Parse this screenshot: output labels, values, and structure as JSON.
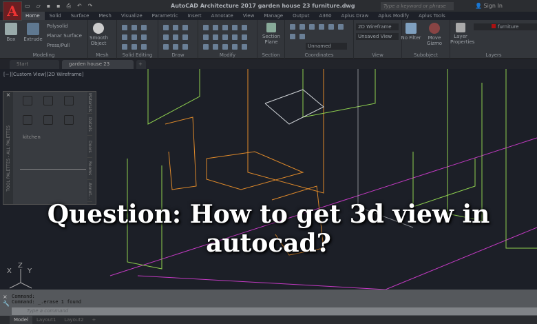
{
  "app": {
    "logo": "A",
    "title": "AutoCAD Architecture 2017   garden house 23 furniture.dwg",
    "search_placeholder": "Type a keyword or phrase",
    "sign_in": "Sign In"
  },
  "ribbon_tabs": [
    "Home",
    "Solid",
    "Surface",
    "Mesh",
    "Visualize",
    "Parametric",
    "Insert",
    "Annotate",
    "View",
    "Manage",
    "Output",
    "A360",
    "Aplus Draw",
    "Aplus Modify",
    "Aplus Tools"
  ],
  "active_tab": "Home",
  "panels": {
    "modeling": "Modeling",
    "mesh": "Mesh",
    "solid_editing": "Solid Editing",
    "draw": "Draw",
    "modify": "Modify",
    "section": "Section",
    "coordinates": "Coordinates",
    "view": "View",
    "subobject": "Subobject",
    "layers": "Layers"
  },
  "buttons": {
    "box": "Box",
    "extrude": "Extrude",
    "polysolid": "Polysolid",
    "planar_surface": "Planar Surface",
    "presspull": "Press/Pull",
    "smooth_object": "Smooth Object",
    "section_plane": "Section Plane",
    "no_filter": "No Filter",
    "move_gizmo": "Move Gizmo",
    "layer_properties": "Layer Properties"
  },
  "dropdowns": {
    "visual_style": "2D Wireframe",
    "named_view": "Unsaved View",
    "ucs": "Unnamed",
    "layer": "furniture"
  },
  "doc_tabs": [
    "Start",
    "garden house 23 furniture*"
  ],
  "viewport": {
    "label": "[−][Custom View][2D Wireframe]",
    "palette_category": "kitchen",
    "palette_title": "TOOL PALETTES - ALL PALETTES",
    "palette_side_tabs": [
      "Materials",
      "Details",
      "Doors",
      "Rooms",
      "Annot..."
    ]
  },
  "headline": "Question: How to get 3d view in autocad?",
  "command": {
    "lines": [
      "Command:",
      "Command:  _.erase 1 found"
    ],
    "placeholder": "Type a command"
  },
  "layout_tabs": [
    "Model",
    "Layout1",
    "Layout2"
  ],
  "colors": {
    "wire_green": "#8fd14f",
    "wire_orange": "#e08a2a",
    "wire_magenta": "#c43ac4",
    "wire_white": "#d0d4d8"
  }
}
